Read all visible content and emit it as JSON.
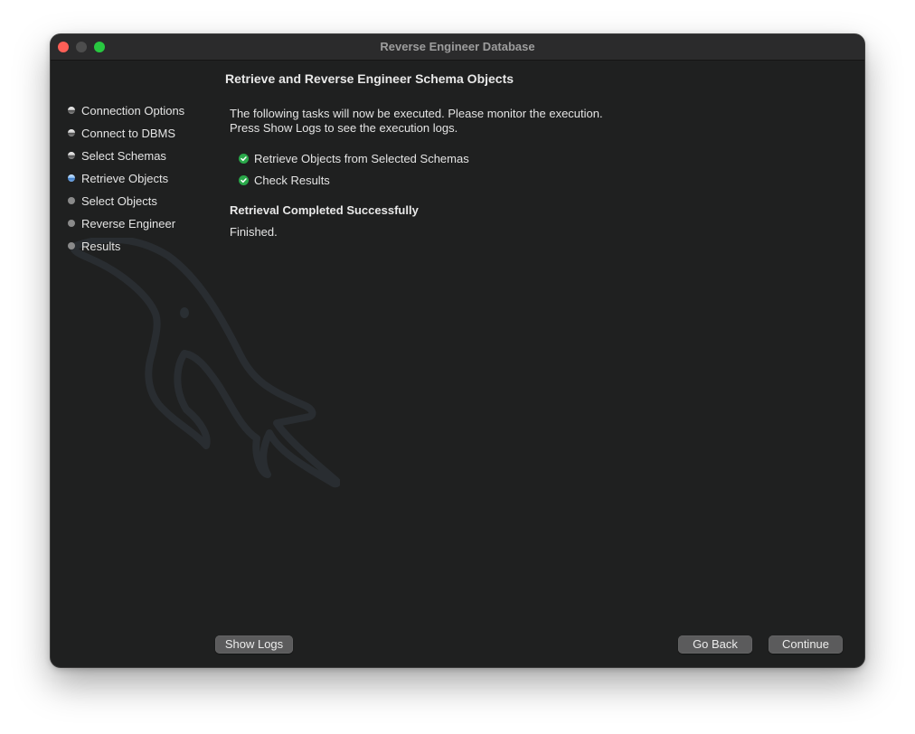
{
  "window": {
    "title": "Reverse Engineer Database"
  },
  "sidebar": {
    "steps": [
      {
        "label": "Connection Options",
        "state": "done"
      },
      {
        "label": "Connect to DBMS",
        "state": "done"
      },
      {
        "label": "Select Schemas",
        "state": "done"
      },
      {
        "label": "Retrieve Objects",
        "state": "current"
      },
      {
        "label": "Select Objects",
        "state": "pending"
      },
      {
        "label": "Reverse Engineer",
        "state": "pending"
      },
      {
        "label": "Results",
        "state": "pending"
      }
    ]
  },
  "main": {
    "heading": "Retrieve and Reverse Engineer Schema Objects",
    "description_line1": "The following tasks will now be executed. Please monitor the execution.",
    "description_line2": "Press Show Logs to see the execution logs.",
    "tasks": [
      {
        "label": "Retrieve Objects from Selected Schemas",
        "status": "success"
      },
      {
        "label": "Check Results",
        "status": "success"
      }
    ],
    "status_text": "Retrieval Completed Successfully",
    "finished_text": "Finished."
  },
  "buttons": {
    "show_logs": "Show Logs",
    "go_back": "Go Back",
    "continue": "Continue"
  },
  "icons": {
    "task_check": "check-circle-icon",
    "background": "dolphin-watermark-icon"
  },
  "colors": {
    "success": "#2aa84a",
    "current_step": "#5a9be6",
    "close": "#fe5f57",
    "maximize": "#28c840"
  }
}
